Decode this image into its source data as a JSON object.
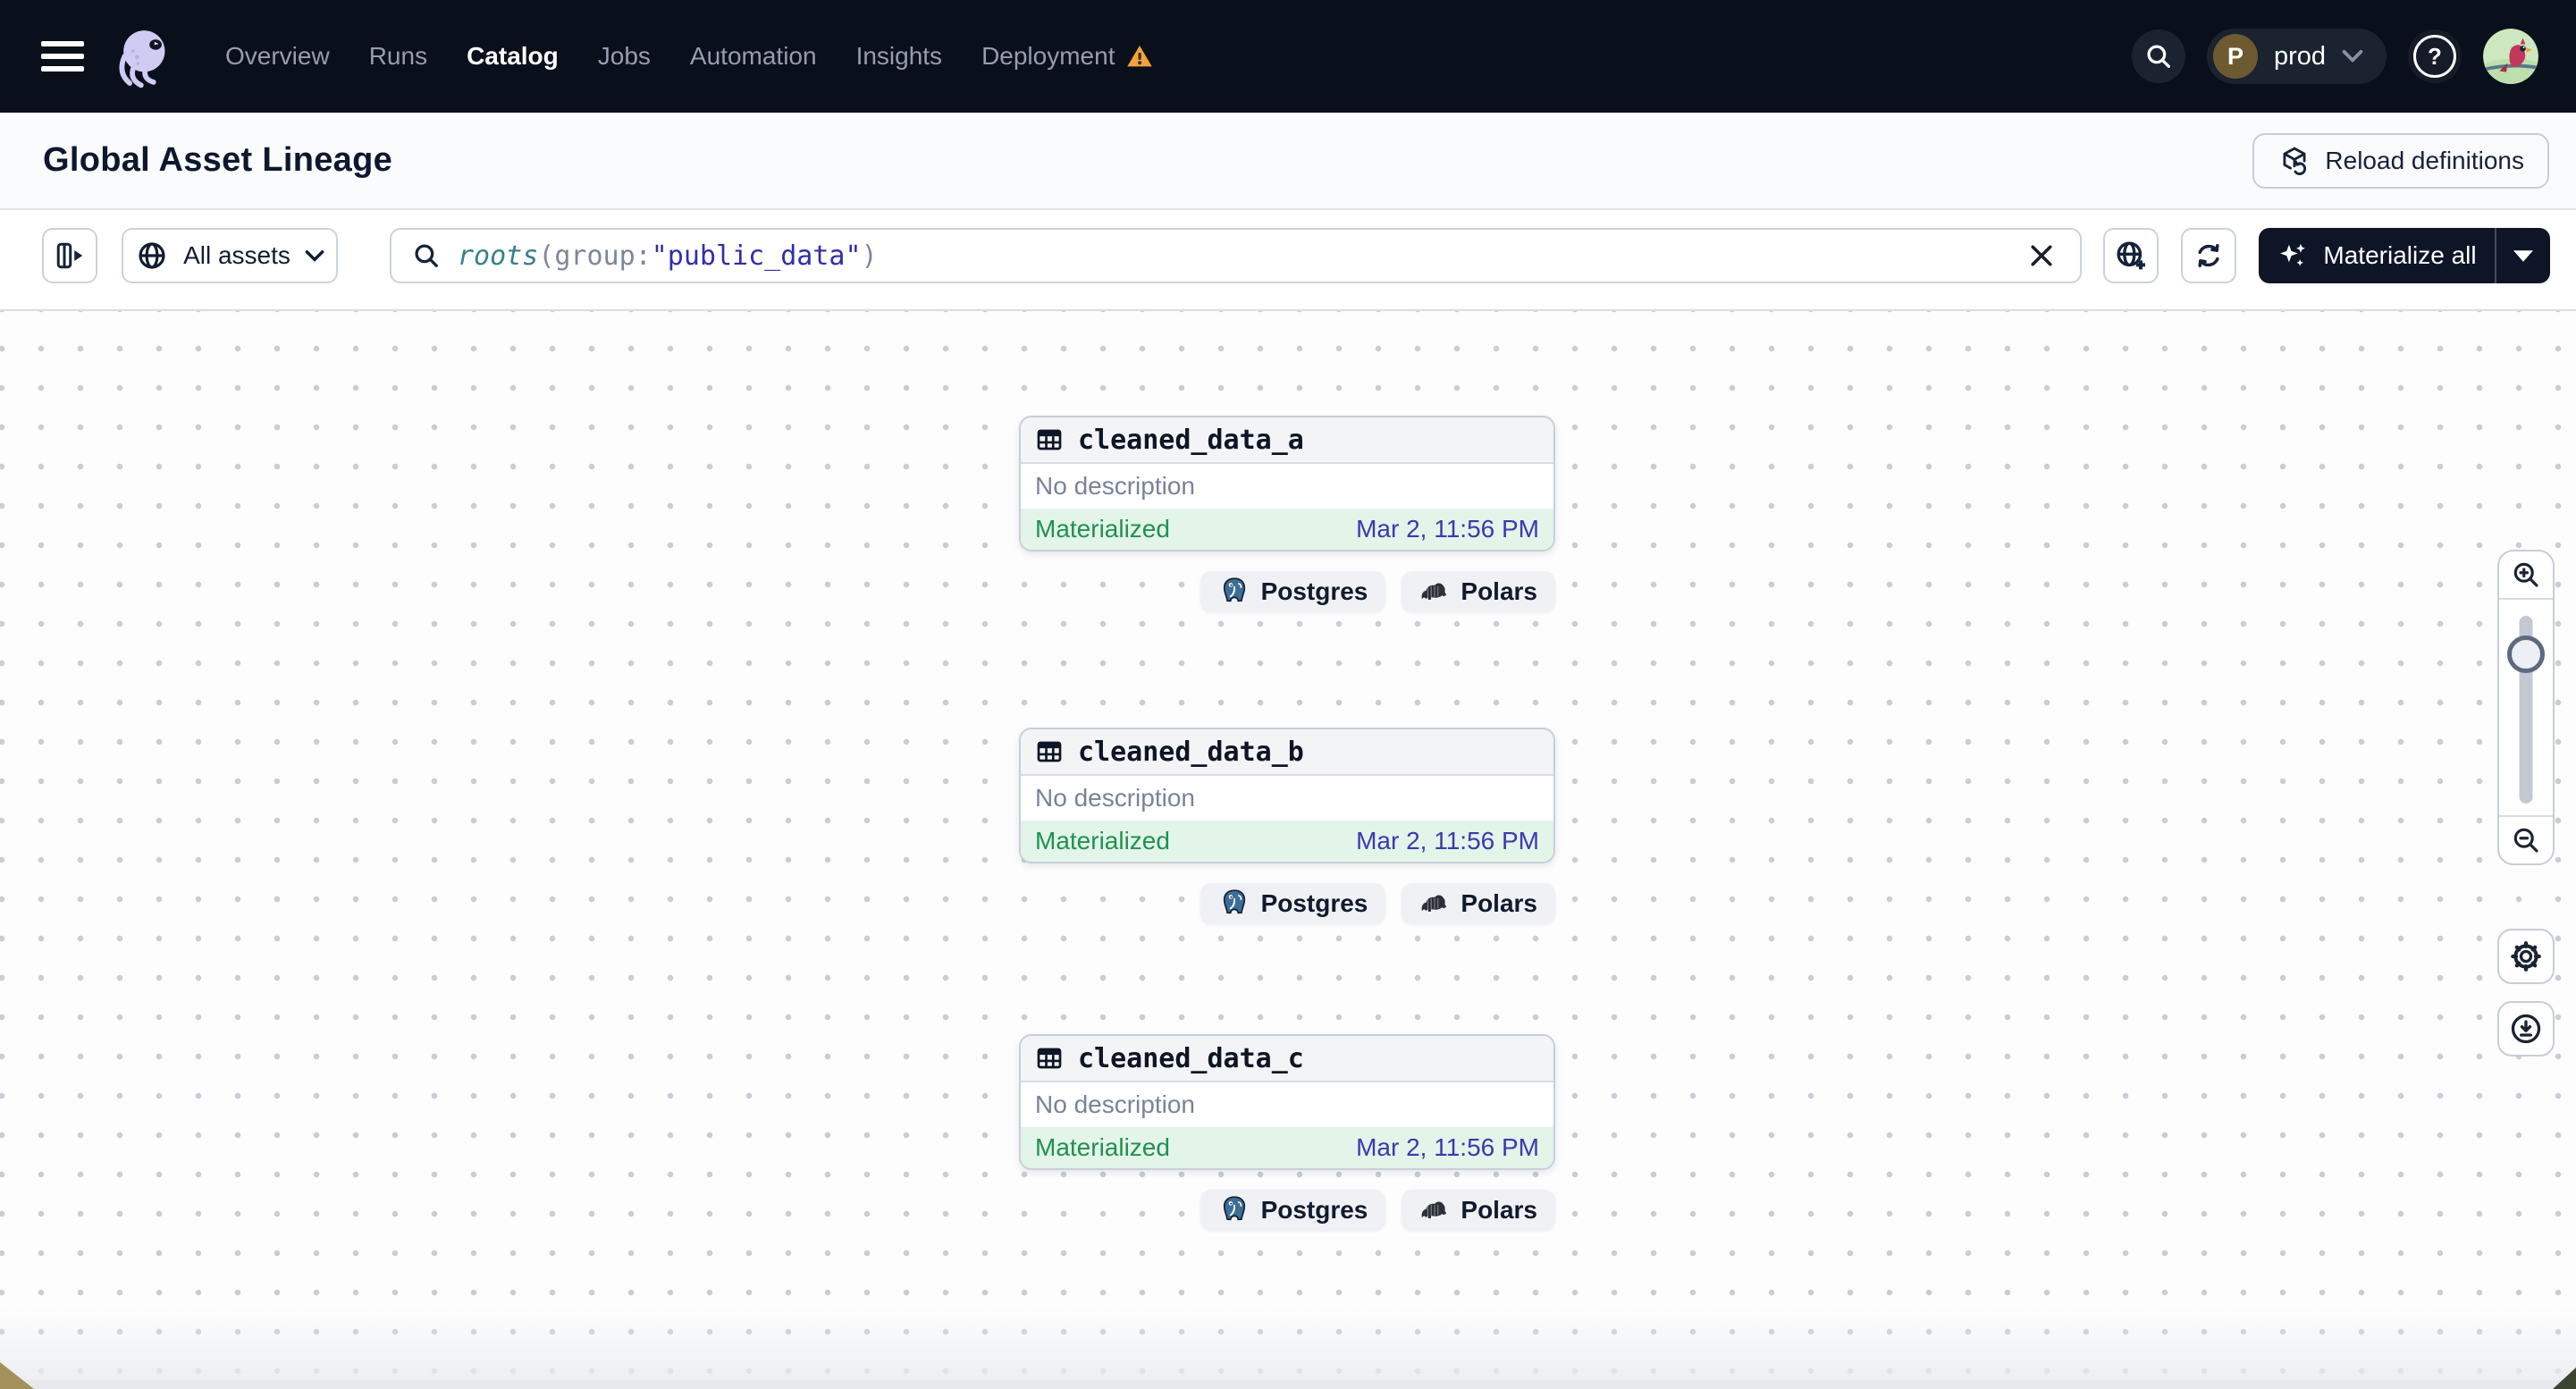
{
  "colors": {
    "navbar_bg": "#0a0f1c",
    "accent_green": "#219150",
    "status_bg_green": "#e3f4e9",
    "timestamp_indigo": "#3c39ae",
    "warning_orange": "#f0a33c",
    "materialize_bg": "#0d1526",
    "postgres_blue": "#3d6e98"
  },
  "navbar": {
    "menu_icon": "hamburger-icon",
    "logo_icon": "dagster-octopus-logo",
    "items": [
      {
        "label": "Overview",
        "active": false
      },
      {
        "label": "Runs",
        "active": false
      },
      {
        "label": "Catalog",
        "active": true
      },
      {
        "label": "Jobs",
        "active": false
      },
      {
        "label": "Automation",
        "active": false
      },
      {
        "label": "Insights",
        "active": false
      },
      {
        "label": "Deployment",
        "active": false,
        "warning": true
      }
    ],
    "search_icon": "search-icon",
    "environment": {
      "badge": "P",
      "name": "prod",
      "chevron_icon": "chevron-down-icon"
    },
    "help_glyph": "?",
    "avatar_icon": "user-avatar-bird"
  },
  "header": {
    "title": "Global Asset Lineage",
    "reload_button_label": "Reload definitions",
    "reload_icon": "cube-reload-icon"
  },
  "toolbar": {
    "panel_toggle_icon": "expand-panel-icon",
    "scope_button": {
      "icon": "globe-icon",
      "label": "All assets",
      "chevron_icon": "chevron-down-icon"
    },
    "search": {
      "icon": "search-icon",
      "query_segments": [
        {
          "text": "roots",
          "style": "function"
        },
        {
          "text": "(",
          "style": "punct"
        },
        {
          "text": "group:",
          "style": "key"
        },
        {
          "text": "\"public_data\"",
          "style": "string"
        },
        {
          "text": ")",
          "style": "punct"
        }
      ],
      "clear_icon": "close-icon"
    },
    "globe_add_icon": "globe-add-icon",
    "refresh_icon": "refresh-icon",
    "materialize_button": {
      "icon": "sparkles-icon",
      "label": "Materialize all",
      "caret_icon": "caret-down-icon"
    }
  },
  "graph": {
    "nodes": [
      {
        "icon": "table-icon",
        "name": "cleaned_data_a",
        "description": "No description",
        "status": "Materialized",
        "timestamp": "Mar 2, 11:56 PM",
        "tags": [
          {
            "icon": "postgres-icon",
            "label": "Postgres"
          },
          {
            "icon": "polars-icon",
            "label": "Polars"
          }
        ]
      },
      {
        "icon": "table-icon",
        "name": "cleaned_data_b",
        "description": "No description",
        "status": "Materialized",
        "timestamp": "Mar 2, 11:56 PM",
        "tags": [
          {
            "icon": "postgres-icon",
            "label": "Postgres"
          },
          {
            "icon": "polars-icon",
            "label": "Polars"
          }
        ]
      },
      {
        "icon": "table-icon",
        "name": "cleaned_data_c",
        "description": "No description",
        "status": "Materialized",
        "timestamp": "Mar 2, 11:56 PM",
        "tags": [
          {
            "icon": "postgres-icon",
            "label": "Postgres"
          },
          {
            "icon": "polars-icon",
            "label": "Polars"
          }
        ]
      }
    ]
  },
  "view_controls": {
    "zoom_in_icon": "zoom-in-icon",
    "zoom_out_icon": "zoom-out-icon",
    "slider": "zoom-slider",
    "settings_icon": "gear-icon",
    "download_icon": "download-icon"
  }
}
